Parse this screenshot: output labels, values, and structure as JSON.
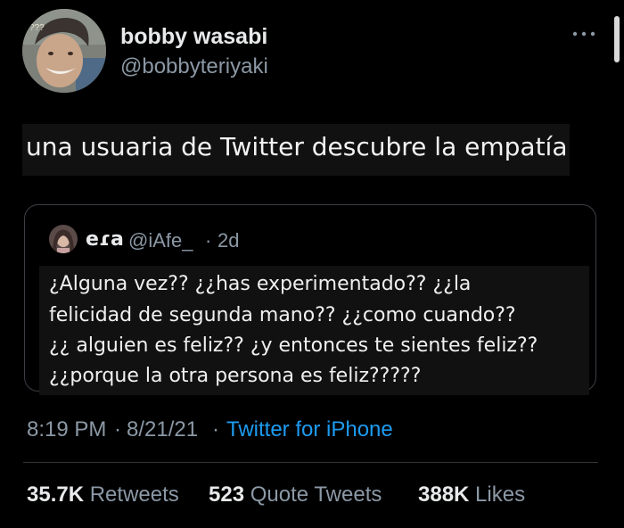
{
  "author": {
    "name": "bobby wasabi",
    "handle": "@bobbyteriyaki",
    "avatar_overlay_text": "???"
  },
  "tweet_text": "una usuaria de Twitter descubre la empatía",
  "quote": {
    "name": "eɾa",
    "handle": "@iAfe_",
    "separator": "·",
    "time": "2d",
    "lines": [
      "¿Alguna vez??  ¿¿has experimentado?? ¿¿la",
      "felicidad de segunda mano?? ¿¿como cuando??",
      "¿¿ alguien es feliz?? ¿y entonces te sientes feliz??",
      "¿¿porque la otra persona es feliz?????"
    ]
  },
  "meta": {
    "time": "8:19 PM",
    "date": "8/21/21",
    "separator": "·",
    "source": "Twitter for iPhone"
  },
  "stats": {
    "retweets_count": "35.7K",
    "retweets_label": "Retweets",
    "quotes_count": "523",
    "quotes_label": "Quote Tweets",
    "likes_count": "388K",
    "likes_label": "Likes"
  },
  "colors": {
    "background": "#000000",
    "primary_text": "#e7e9ea",
    "secondary_text": "#8b98a5",
    "link": "#1d9bf0",
    "border": "#2f3336"
  },
  "icons": {
    "more": "more-horizontal-icon"
  }
}
